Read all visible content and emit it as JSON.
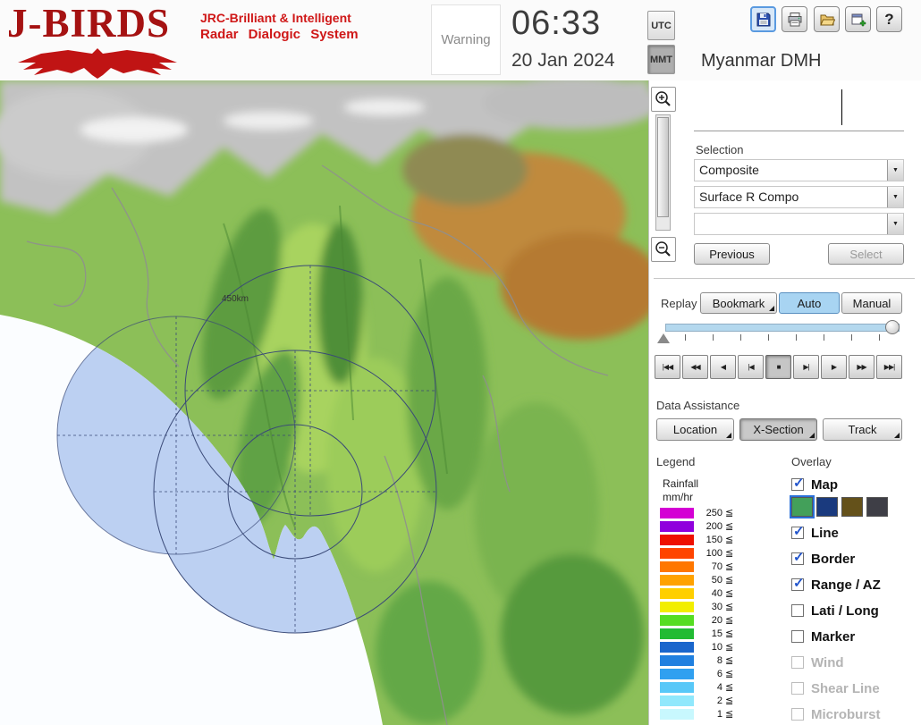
{
  "header": {
    "logo": {
      "title": "J-BIRDS",
      "subtitle_line1": "JRC-Brilliant & Intelligent",
      "subtitle_line2": "Radar Dialogic System"
    },
    "warning_label": "Warning",
    "clock": {
      "time": "06:33",
      "date": "20 Jan 2024"
    },
    "timezone": {
      "utc_label": "UTC",
      "mmt_label": "MMT",
      "mmt_selected": true
    },
    "toolbar": {
      "help_glyph": "?"
    },
    "org_name": "Myanmar DMH"
  },
  "map": {
    "range_label": "450km"
  },
  "icons": {
    "dropdown_arrow": "▼",
    "check": "✓"
  },
  "selection_panel": {
    "label": "Selection",
    "dropdown1_value": "Composite",
    "dropdown2_value": "Surface R Compo",
    "dropdown3_value": "",
    "previous_label": "Previous",
    "select_label": "Select",
    "select_disabled": true
  },
  "replay": {
    "label": "Replay",
    "bookmark_label": "Bookmark",
    "auto_label": "Auto",
    "manual_label": "Manual",
    "auto_selected": true,
    "stop_pressed": true,
    "transport": [
      "|◀◀",
      "◀◀",
      "◀",
      "|◀",
      "■",
      "▶|",
      "▶",
      "▶▶",
      "▶▶|"
    ]
  },
  "data_assistance": {
    "label": "Data Assistance",
    "location_label": "Location",
    "xsection_label": "X-Section",
    "track_label": "Track",
    "xsection_pressed": true
  },
  "legend": {
    "title": "Legend",
    "unit_line1": "Rainfall",
    "unit_line2": "mm/hr",
    "suffix": "≦",
    "rows": [
      {
        "value": "250",
        "color": "#d400d4"
      },
      {
        "value": "200",
        "color": "#9000dd"
      },
      {
        "value": "150",
        "color": "#ee1000"
      },
      {
        "value": "100",
        "color": "#ff4400"
      },
      {
        "value": "70",
        "color": "#ff7700"
      },
      {
        "value": "50",
        "color": "#ffa200"
      },
      {
        "value": "40",
        "color": "#ffcf00"
      },
      {
        "value": "30",
        "color": "#f2ee00"
      },
      {
        "value": "20",
        "color": "#55dd22"
      },
      {
        "value": "15",
        "color": "#22bb33"
      },
      {
        "value": "10",
        "color": "#1a66cc"
      },
      {
        "value": "8",
        "color": "#2080e0"
      },
      {
        "value": "6",
        "color": "#30a0f0"
      },
      {
        "value": "4",
        "color": "#58c8f8"
      },
      {
        "value": "2",
        "color": "#90e8fc"
      },
      {
        "value": "1",
        "color": "#c8f8fe"
      }
    ]
  },
  "overlay": {
    "title": "Overlay",
    "items": [
      {
        "label": "Map",
        "checked": true,
        "disabled": false
      },
      {
        "label": "Line",
        "checked": true,
        "disabled": false
      },
      {
        "label": "Border",
        "checked": true,
        "disabled": false
      },
      {
        "label": "Range / AZ",
        "checked": true,
        "disabled": false
      },
      {
        "label": "Lati / Long",
        "checked": false,
        "disabled": false
      },
      {
        "label": "Marker",
        "checked": false,
        "disabled": false
      },
      {
        "label": "Wind",
        "checked": false,
        "disabled": true
      },
      {
        "label": "Shear Line",
        "checked": false,
        "disabled": true
      },
      {
        "label": "Microburst",
        "checked": false,
        "disabled": true
      }
    ],
    "map_styles": [
      {
        "color": "#43a05a",
        "selected": true
      },
      {
        "color": "#1a3a7e",
        "selected": false
      },
      {
        "color": "#64511a",
        "selected": false
      },
      {
        "color": "#3e3e46",
        "selected": false
      }
    ]
  }
}
